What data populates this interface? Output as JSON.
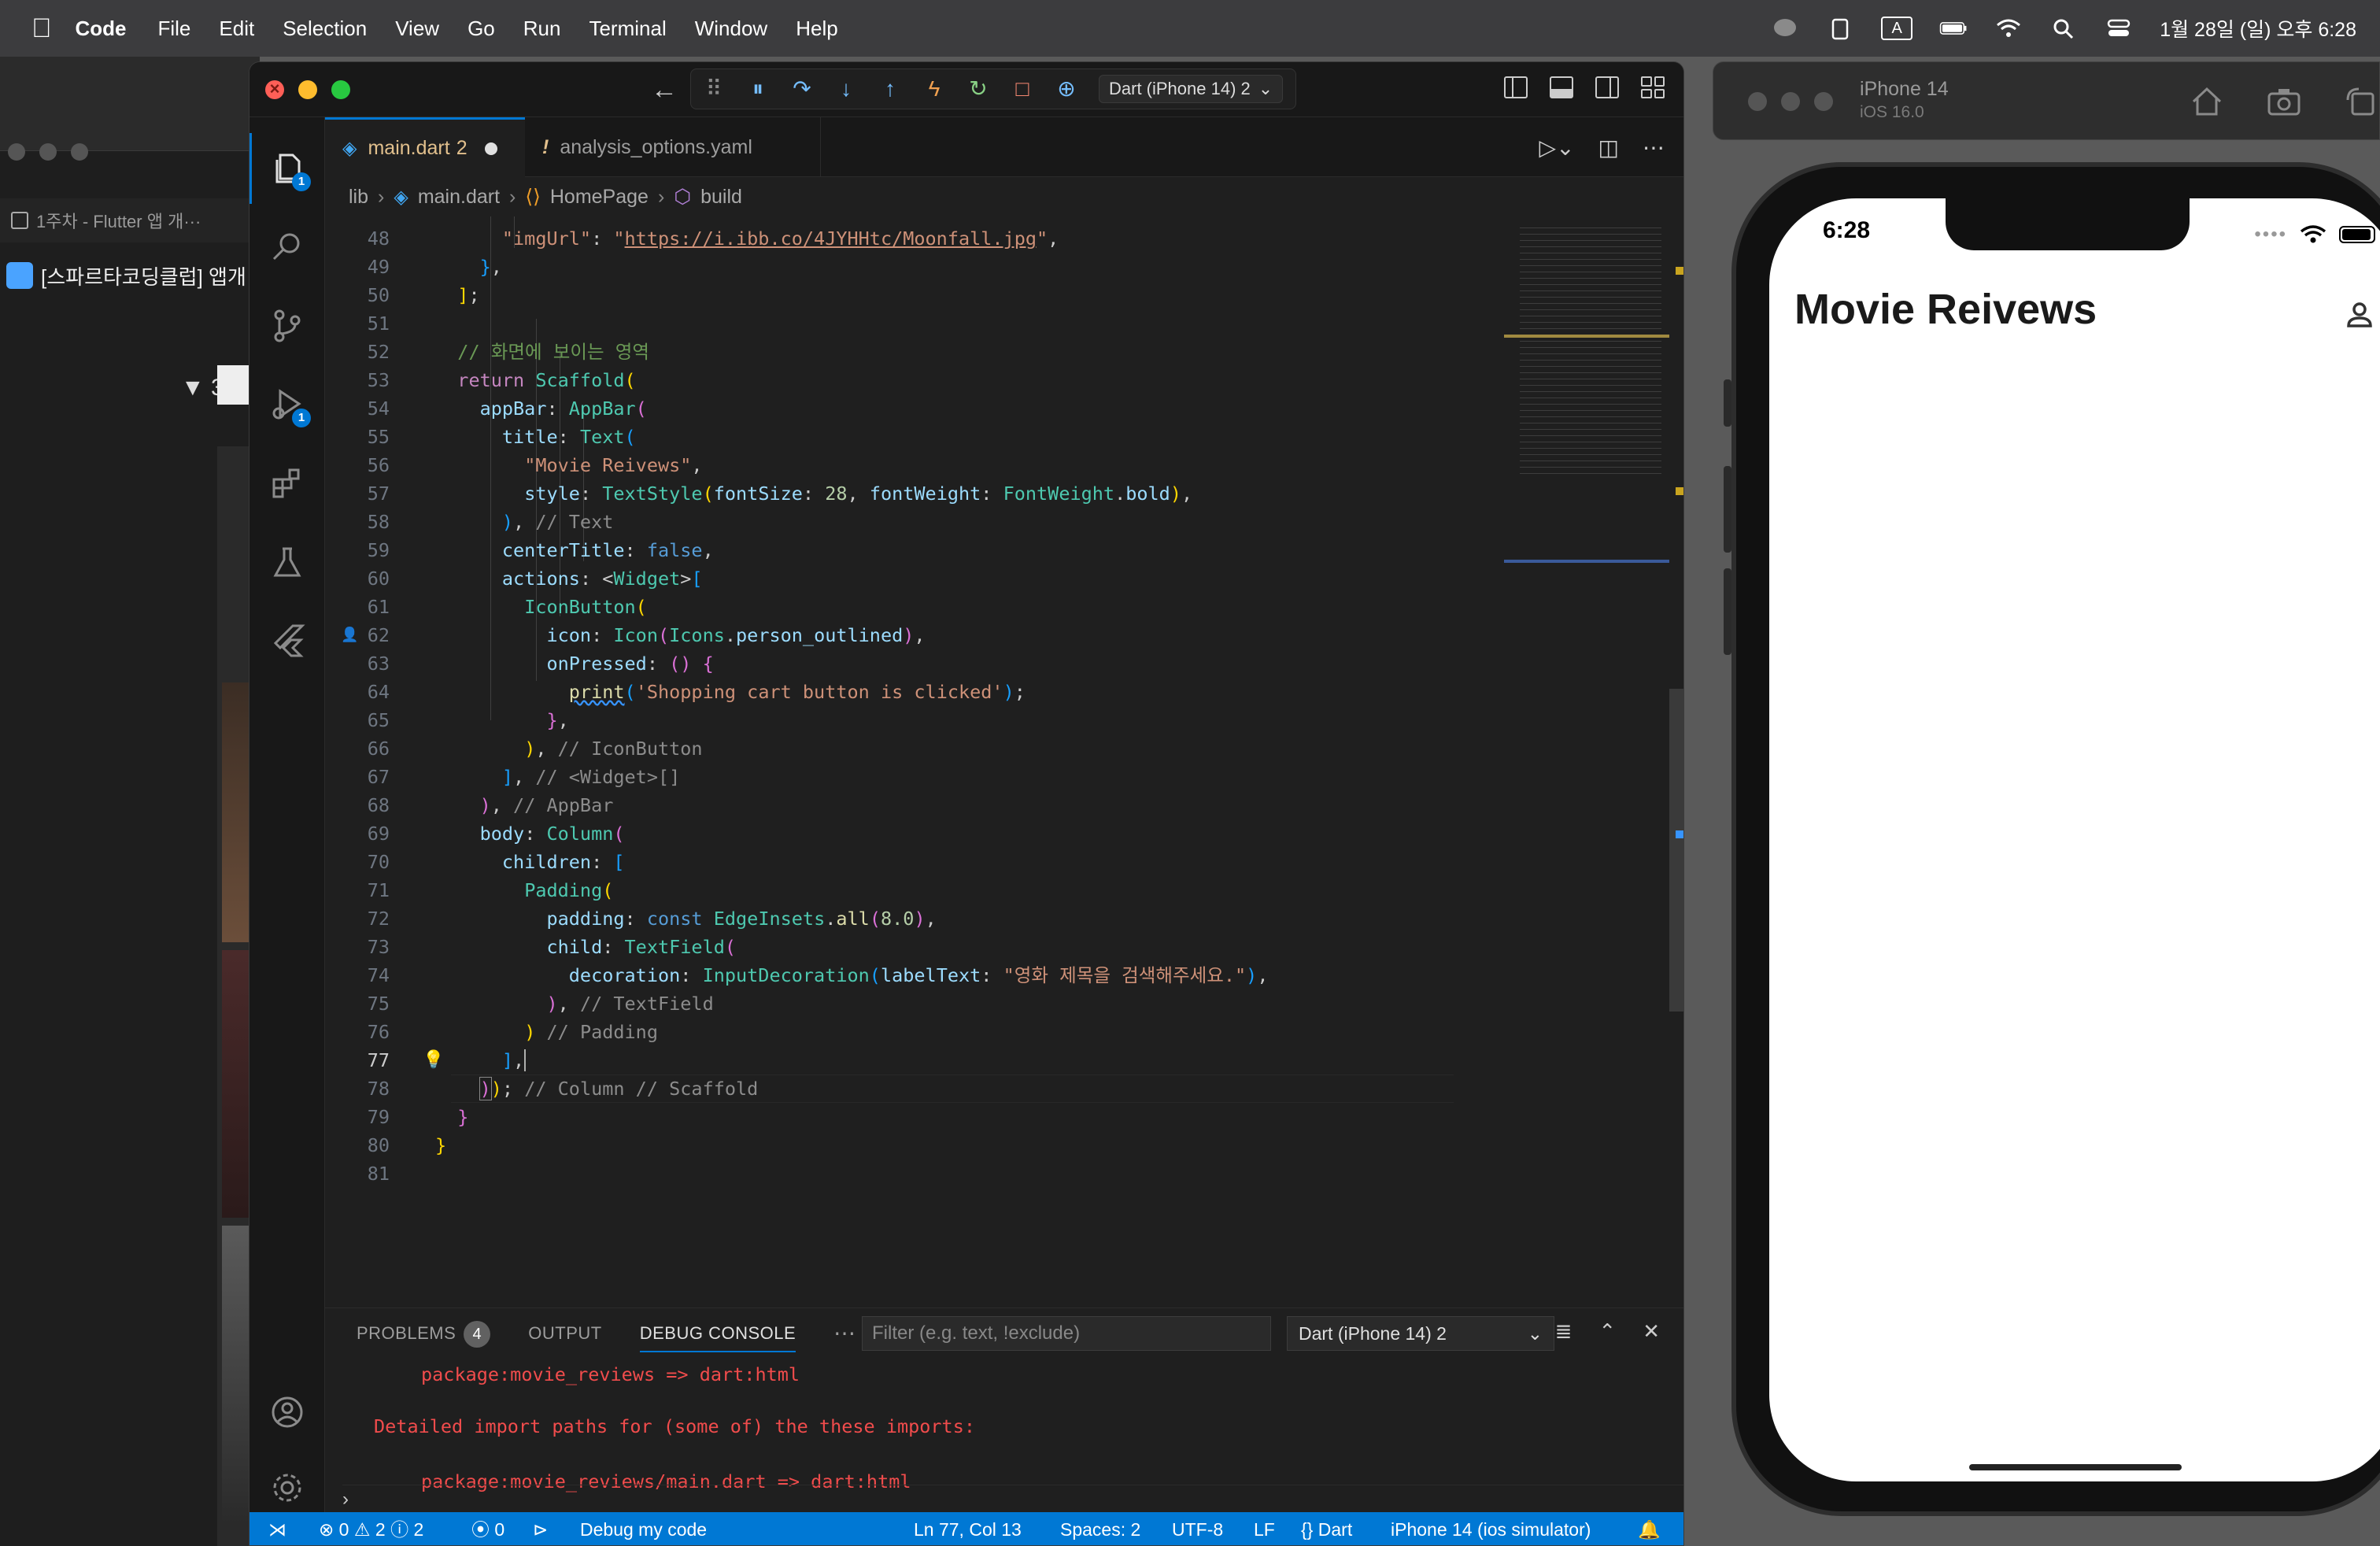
{
  "menubar": {
    "app": "Code",
    "menus": [
      "File",
      "Edit",
      "Selection",
      "View",
      "Go",
      "Run",
      "Terminal",
      "Window",
      "Help"
    ],
    "datetime": "1월 28일 (일) 오후 6:28",
    "input_indicator": "A"
  },
  "bg_window": {
    "tab_label": "1주차 - Flutter 앱 개···",
    "page_title": "[스파르타코딩클럽] 앱개",
    "toggle_label": "3)"
  },
  "titlebar": {
    "debug_config": "Dart (iPhone 14) 2"
  },
  "activity": {
    "explorer_badge": "1",
    "debug_badge": "1"
  },
  "tabs": [
    {
      "label": "main.dart",
      "suffix": "2",
      "modified": true
    },
    {
      "label": "analysis_options.yaml",
      "marker": "!"
    }
  ],
  "breadcrumb": [
    "lib",
    "main.dart",
    "HomePage",
    "build"
  ],
  "editor": {
    "first_line": 48,
    "current_line": 77,
    "url": "https://i.ibb.co/4JYHHtc/Moonfall.jpg",
    "comment_visible_area": "// 화면에 보이는 영역",
    "title_text": "\"Movie Reivews\"",
    "print_text": "'Shopping cart button is clicked'",
    "label_text": "\"영화 제목을 검색해주세요.\"",
    "font_size": "28",
    "padding_value": "8.0"
  },
  "panel": {
    "tabs": [
      "PROBLEMS",
      "OUTPUT",
      "DEBUG CONSOLE"
    ],
    "problems_count": "4",
    "filter_placeholder": "Filter (e.g. text, !exclude)",
    "session": "Dart (iPhone 14) 2",
    "console_lines": [
      "package:movie_reviews => dart:html",
      "Detailed import paths for (some of) the these imports:",
      "package:movie_reviews/main.dart => dart:html"
    ]
  },
  "statusbar": {
    "errors": "0",
    "warnings": "2",
    "infos": "2",
    "ports": "0",
    "debug_label": "Debug my code",
    "position": "Ln 77, Col 13",
    "spaces": "Spaces: 2",
    "encoding": "UTF-8",
    "eol": "LF",
    "language": "Dart",
    "device": "iPhone 14 (ios simulator)"
  },
  "simulator": {
    "device": "iPhone 14",
    "os": "iOS 16.0",
    "time": "6:28",
    "app_title": "Movie Reivews"
  }
}
